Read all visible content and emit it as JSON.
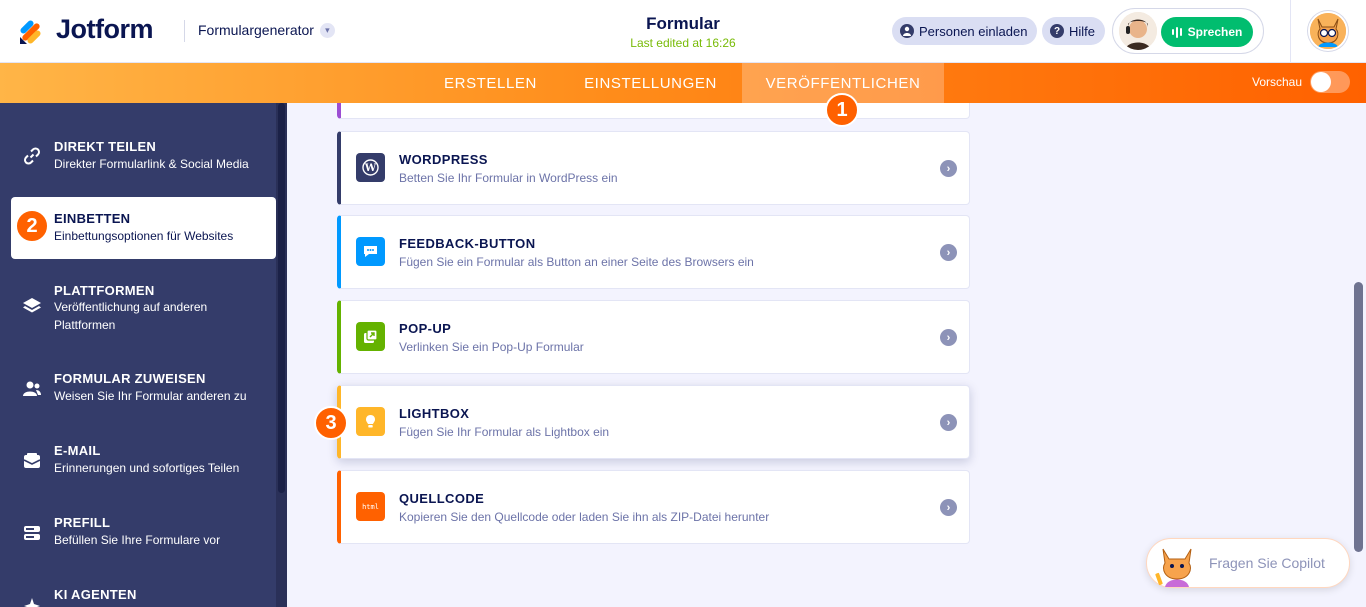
{
  "header": {
    "logo_text": "Jotform",
    "form_generator": "Formulargenerator",
    "form_title": "Formular",
    "last_edited": "Last edited at 16:26",
    "invite_label": "Personen einladen",
    "help_label": "Hilfe",
    "speak_label": "Sprechen"
  },
  "tabs": [
    {
      "label": "ERSTELLEN",
      "active": false
    },
    {
      "label": "EINSTELLUNGEN",
      "active": false
    },
    {
      "label": "VERÖFFENTLICHEN",
      "active": true
    }
  ],
  "preview_label": "Vorschau",
  "badges": [
    "1",
    "2",
    "3"
  ],
  "sidebar": {
    "items": [
      {
        "title": "DIREKT TEILEN",
        "subtitle": "Direkter Formularlink & Social Media",
        "icon": "link-icon",
        "active": false
      },
      {
        "title": "EINBETTEN",
        "subtitle": "Einbettungsoptionen für Websites",
        "icon": "code-icon",
        "active": true
      },
      {
        "title": "PLATTFORMEN",
        "subtitle": "Veröffentlichung auf anderen Plattformen",
        "icon": "layers-icon",
        "active": false
      },
      {
        "title": "FORMULAR ZUWEISEN",
        "subtitle": "Weisen Sie Ihr Formular anderen zu",
        "icon": "users-icon",
        "active": false
      },
      {
        "title": "E-MAIL",
        "subtitle": "Erinnerungen und sofortiges Teilen",
        "icon": "mail-icon",
        "active": false
      },
      {
        "title": "PREFILL",
        "subtitle": "Befüllen Sie Ihre Formulare vor",
        "icon": "prefill-icon",
        "active": false
      },
      {
        "title": "KI AGENTEN",
        "subtitle": "",
        "icon": "ai-icon",
        "active": false
      }
    ]
  },
  "cards": [
    {
      "title": "WORDPRESS",
      "subtitle": "Betten Sie Ihr Formular in WordPress ein",
      "icon": "wordpress-icon",
      "color": "#343c6a"
    },
    {
      "title": "FEEDBACK-BUTTON",
      "subtitle": "Fügen Sie ein Formular als Button an einer Seite des Browsers ein",
      "icon": "chat-bubble-icon",
      "color": "#0099ff"
    },
    {
      "title": "POP-UP",
      "subtitle": "Verlinken Sie ein Pop-Up Formular",
      "icon": "popup-icon",
      "color": "#64b200"
    },
    {
      "title": "LIGHTBOX",
      "subtitle": "Fügen Sie Ihr Formular als Lightbox ein",
      "icon": "lightbulb-icon",
      "color": "#ffb629"
    },
    {
      "title": "QUELLCODE",
      "subtitle": "Kopieren Sie den Quellcode oder laden Sie ihn als ZIP-Datei herunter",
      "icon": "html-icon",
      "icon_text": "html",
      "color": "#ff6100"
    }
  ],
  "copilot_label": "Fragen Sie Copilot",
  "colors": {
    "accent_orange": "#ff6100",
    "navy": "#0a1551",
    "sidebar_bg": "#343c6a",
    "green": "#01bd6f"
  }
}
